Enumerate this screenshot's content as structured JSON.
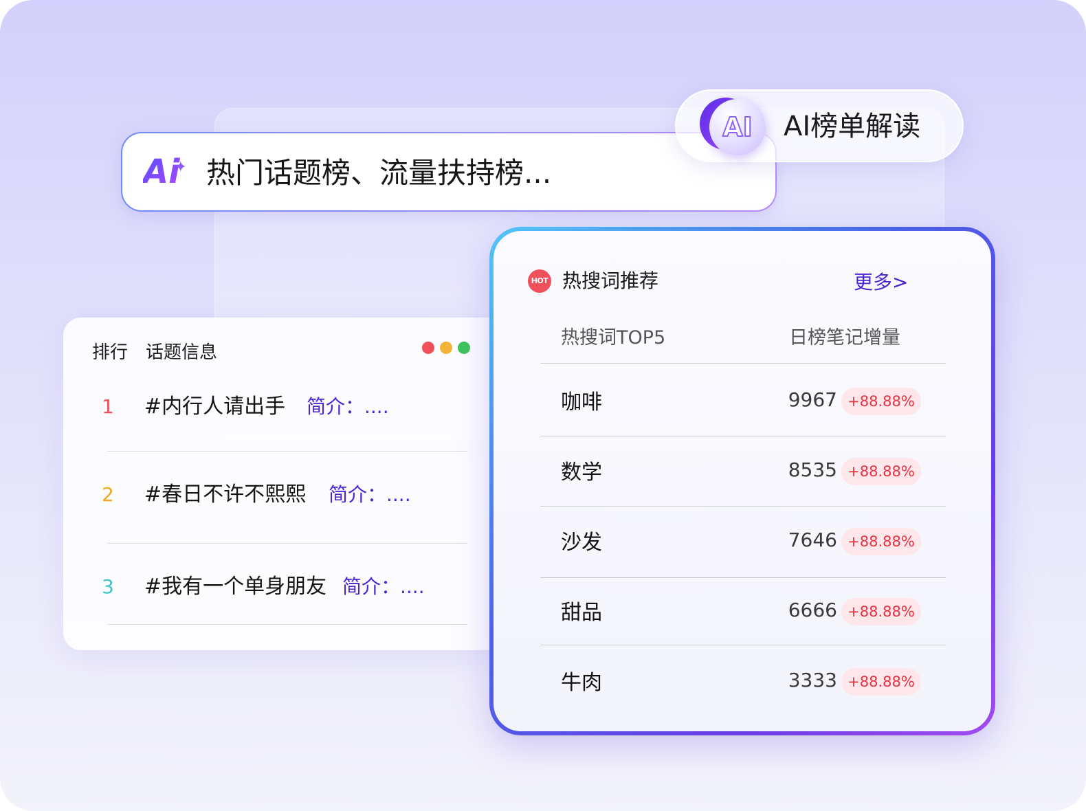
{
  "ai_search": {
    "logo_text": "Ai",
    "query": "热门话题榜、流量扶持榜..."
  },
  "ai_badge": {
    "orb_text": "AI",
    "label": "AI榜单解读"
  },
  "topic_card": {
    "header_rank": "排行",
    "header_info": "话题信息",
    "window_dots": [
      "#f0505a",
      "#f4b43c",
      "#3fc35a"
    ],
    "rows": [
      {
        "rank": "1",
        "topic": "#内行人请出手",
        "desc": "简介：....",
        "rank_color": "#f0505a"
      },
      {
        "rank": "2",
        "topic": "#春日不许不熙熙",
        "desc": "简介：....",
        "rank_color": "#f2a623"
      },
      {
        "rank": "3",
        "topic": "#我有一个单身朋友",
        "desc": "简介：....",
        "rank_color": "#44c2c8"
      }
    ]
  },
  "hot_card": {
    "badge": "HOT",
    "title": "热搜词推荐",
    "more": "更多>",
    "col_word": "热搜词TOP5",
    "col_growth": "日榜笔记增量",
    "rows": [
      {
        "word": "咖啡",
        "count": "9967",
        "rate": "+88.88%"
      },
      {
        "word": "数学",
        "count": "8535",
        "rate": "+88.88%"
      },
      {
        "word": "沙发",
        "count": "7646",
        "rate": "+88.88%"
      },
      {
        "word": "甜品",
        "count": "6666",
        "rate": "+88.88%"
      },
      {
        "word": "牛肉",
        "count": "3333",
        "rate": "+88.88%"
      }
    ]
  }
}
